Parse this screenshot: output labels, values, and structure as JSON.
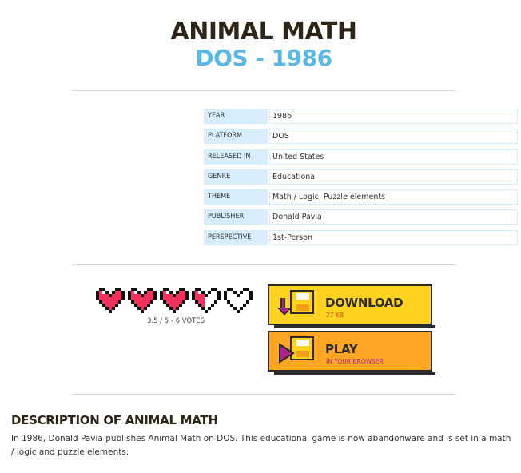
{
  "game": {
    "title": "ANIMAL MATH",
    "subtitle": "DOS - 1986"
  },
  "info": [
    {
      "key": "YEAR",
      "value": "1986"
    },
    {
      "key": "PLATFORM",
      "value": "DOS"
    },
    {
      "key": "RELEASED IN",
      "value": "United States"
    },
    {
      "key": "GENRE",
      "value": "Educational"
    },
    {
      "key": "THEME",
      "value": "Math / Logic, Puzzle elements"
    },
    {
      "key": "PUBLISHER",
      "value": "Donald Pavia"
    },
    {
      "key": "PERSPECTIVE",
      "value": "1st-Person"
    }
  ],
  "rating": {
    "score": 3.5,
    "max": 5,
    "votes_text": "3.5 / 5 - 6 VOTES",
    "filled_color": "#f0325a",
    "icon": "pixel-heart-icon"
  },
  "download_button": {
    "label": "DOWNLOAD",
    "sub": "27 KB",
    "color": "#ffd21f",
    "icon": "floppy-download-icon"
  },
  "play_button": {
    "label": "PLAY",
    "sub": "IN YOUR BROWSER",
    "color": "#ffa724",
    "icon": "floppy-play-icon"
  },
  "description": {
    "title": "DESCRIPTION OF ANIMAL MATH",
    "text": "In 1986, Donald Pavia publishes Animal Math on DOS. This educational game is now abandonware and is set in a math / logic and puzzle elements."
  },
  "colors": {
    "accent_blue": "#5ab8e6",
    "table_key_bg": "#d6eefb"
  }
}
